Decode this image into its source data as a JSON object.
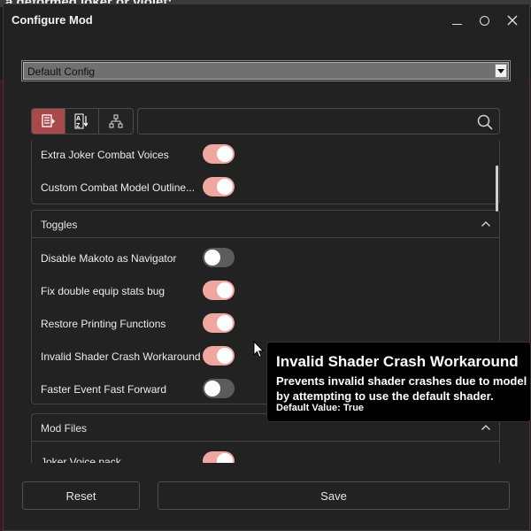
{
  "background": {
    "title_fragment": "a deformed joker or violet:"
  },
  "window": {
    "title": "Configure Mod",
    "minimize_label": "",
    "maximize_label": "",
    "close_label": "X"
  },
  "config": {
    "selected": "Default Config"
  },
  "search": {
    "placeholder": "",
    "value": ""
  },
  "sections": [
    {
      "title": "",
      "items": [
        {
          "label": "Extra Joker Combat Voices",
          "enabled": true
        },
        {
          "label": "Custom Combat Model Outline...",
          "enabled": true
        }
      ]
    },
    {
      "title": "Toggles",
      "items": [
        {
          "label": "Disable Makoto as Navigator",
          "enabled": false
        },
        {
          "label": "Fix double equip stats bug",
          "enabled": true
        },
        {
          "label": "Restore Printing Functions",
          "enabled": true
        },
        {
          "label": "Invalid Shader Crash Workaround",
          "enabled": true
        },
        {
          "label": "Faster Event Fast Forward",
          "enabled": false
        }
      ]
    },
    {
      "title": "Mod Files",
      "items": [
        {
          "label": "Joker Voice pack",
          "enabled": true
        }
      ]
    }
  ],
  "tooltip": {
    "title": "Invalid Shader Crash Workaround",
    "description_line1": "Prevents invalid shader crashes due to model mismatches",
    "description_line2": "by attempting to use the default shader.",
    "default_label": "Default Value:",
    "default_value": "True"
  },
  "buttons": {
    "reset": "Reset",
    "save": "Save"
  },
  "colors": {
    "accent": "#a84a4a",
    "toggle_on": "#f0a7a0",
    "toggle_off": "#5c5c5c"
  }
}
